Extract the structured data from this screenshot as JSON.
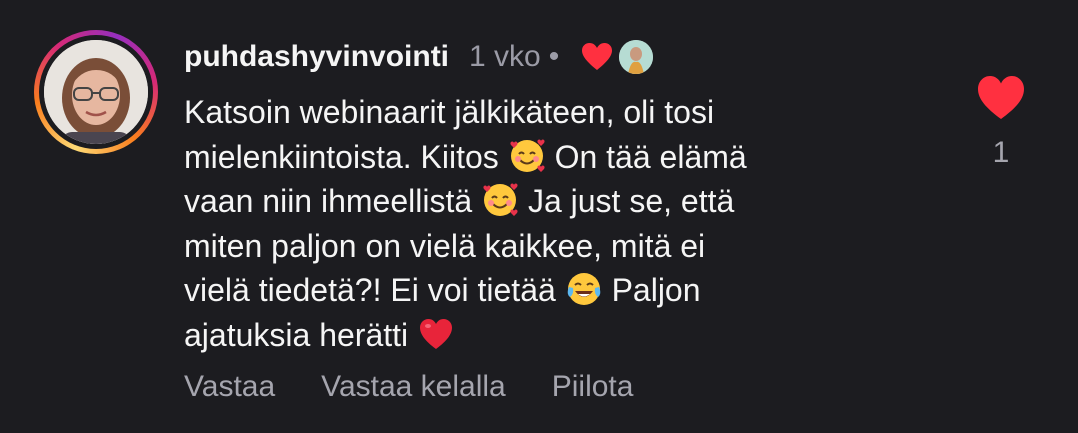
{
  "comment": {
    "username": "puhdashyvinvointi",
    "time": "1 vko",
    "separator": "•",
    "text_lines": [
      "Katsoin webinaarit jälkikäteen, oli tosi",
      "mielenkiintoista. Kiitos",
      "On tää elämä",
      "vaan niin ihmeellistä",
      "Ja just se, että",
      "miten paljon on vielä kaikkee, mitä ei",
      "vielä tiedetä?! Ei voi tietää",
      "Paljon",
      "ajatuksia herätti"
    ],
    "like_count": "1"
  },
  "actions": {
    "reply": "Vastaa",
    "reply_reel": "Vastaa kelalla",
    "hide": "Piilota"
  },
  "colors": {
    "background": "#1c1c20",
    "heart": "#ff3040",
    "muted_text": "#a5a5ae"
  },
  "icons": [
    "avatar",
    "heart-icon",
    "smiling-face-with-hearts-emoji",
    "tears-of-joy-emoji",
    "red-heart-emoji"
  ]
}
